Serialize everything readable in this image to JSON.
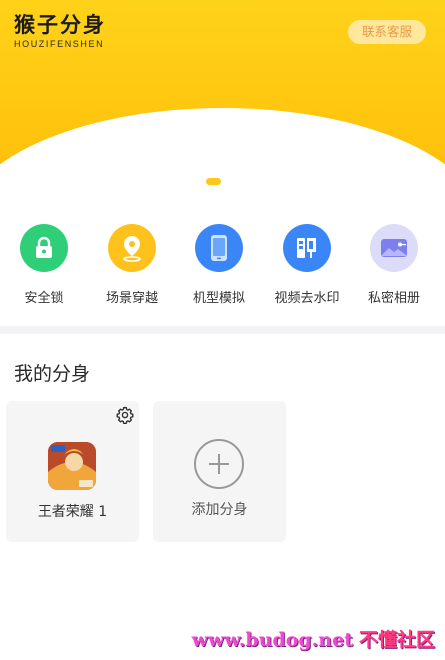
{
  "header": {
    "logo_title": "猴子分身",
    "logo_subtitle": "HOUZIFENSHEN",
    "contact_button": "联系客服",
    "bg_color": "#ffc60f"
  },
  "features": [
    {
      "label": "安全锁",
      "icon": "lock-icon",
      "color": "#2fcf7a"
    },
    {
      "label": "场景穿越",
      "icon": "location-pin-icon",
      "color": "#ffc21c"
    },
    {
      "label": "机型模拟",
      "icon": "phone-icon",
      "color": "#3a86f6"
    },
    {
      "label": "视频去水印",
      "icon": "watermark-stamp-icon",
      "color": "#3a86f6"
    },
    {
      "label": "私密相册",
      "icon": "photo-album-icon",
      "color": "#dcdcf8"
    }
  ],
  "section": {
    "title": "我的分身"
  },
  "clones": [
    {
      "label": "王者荣耀 1",
      "icon": "game-app-icon",
      "settings_icon": "gear-icon"
    }
  ],
  "add_card": {
    "label": "添加分身",
    "icon": "plus-circle-icon"
  },
  "watermark": {
    "url": "www.budog.net",
    "text": "不懂社区"
  }
}
